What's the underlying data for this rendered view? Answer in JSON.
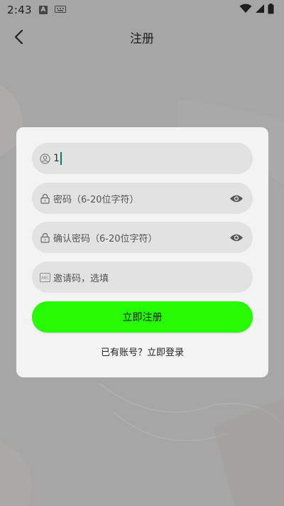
{
  "status_bar": {
    "time": "2:43"
  },
  "header": {
    "title": "注册"
  },
  "form": {
    "username": {
      "value": "1",
      "icon": "user-icon"
    },
    "password": {
      "placeholder": "密码（6-20位字符）",
      "icon": "lock-icon"
    },
    "confirm_password": {
      "placeholder": "确认密码（6-20位字符）",
      "icon": "lock-icon"
    },
    "invite_code": {
      "placeholder": "邀请码，选填",
      "icon": "abc-icon"
    },
    "submit_label": "立即注册",
    "login_link": "已有账号？立即登录"
  },
  "colors": {
    "accent": "#27fb04",
    "background": "#a6a6a6",
    "card": "#f3f3f3",
    "field": "#e2e2e2",
    "cursor": "#0b7a66"
  }
}
